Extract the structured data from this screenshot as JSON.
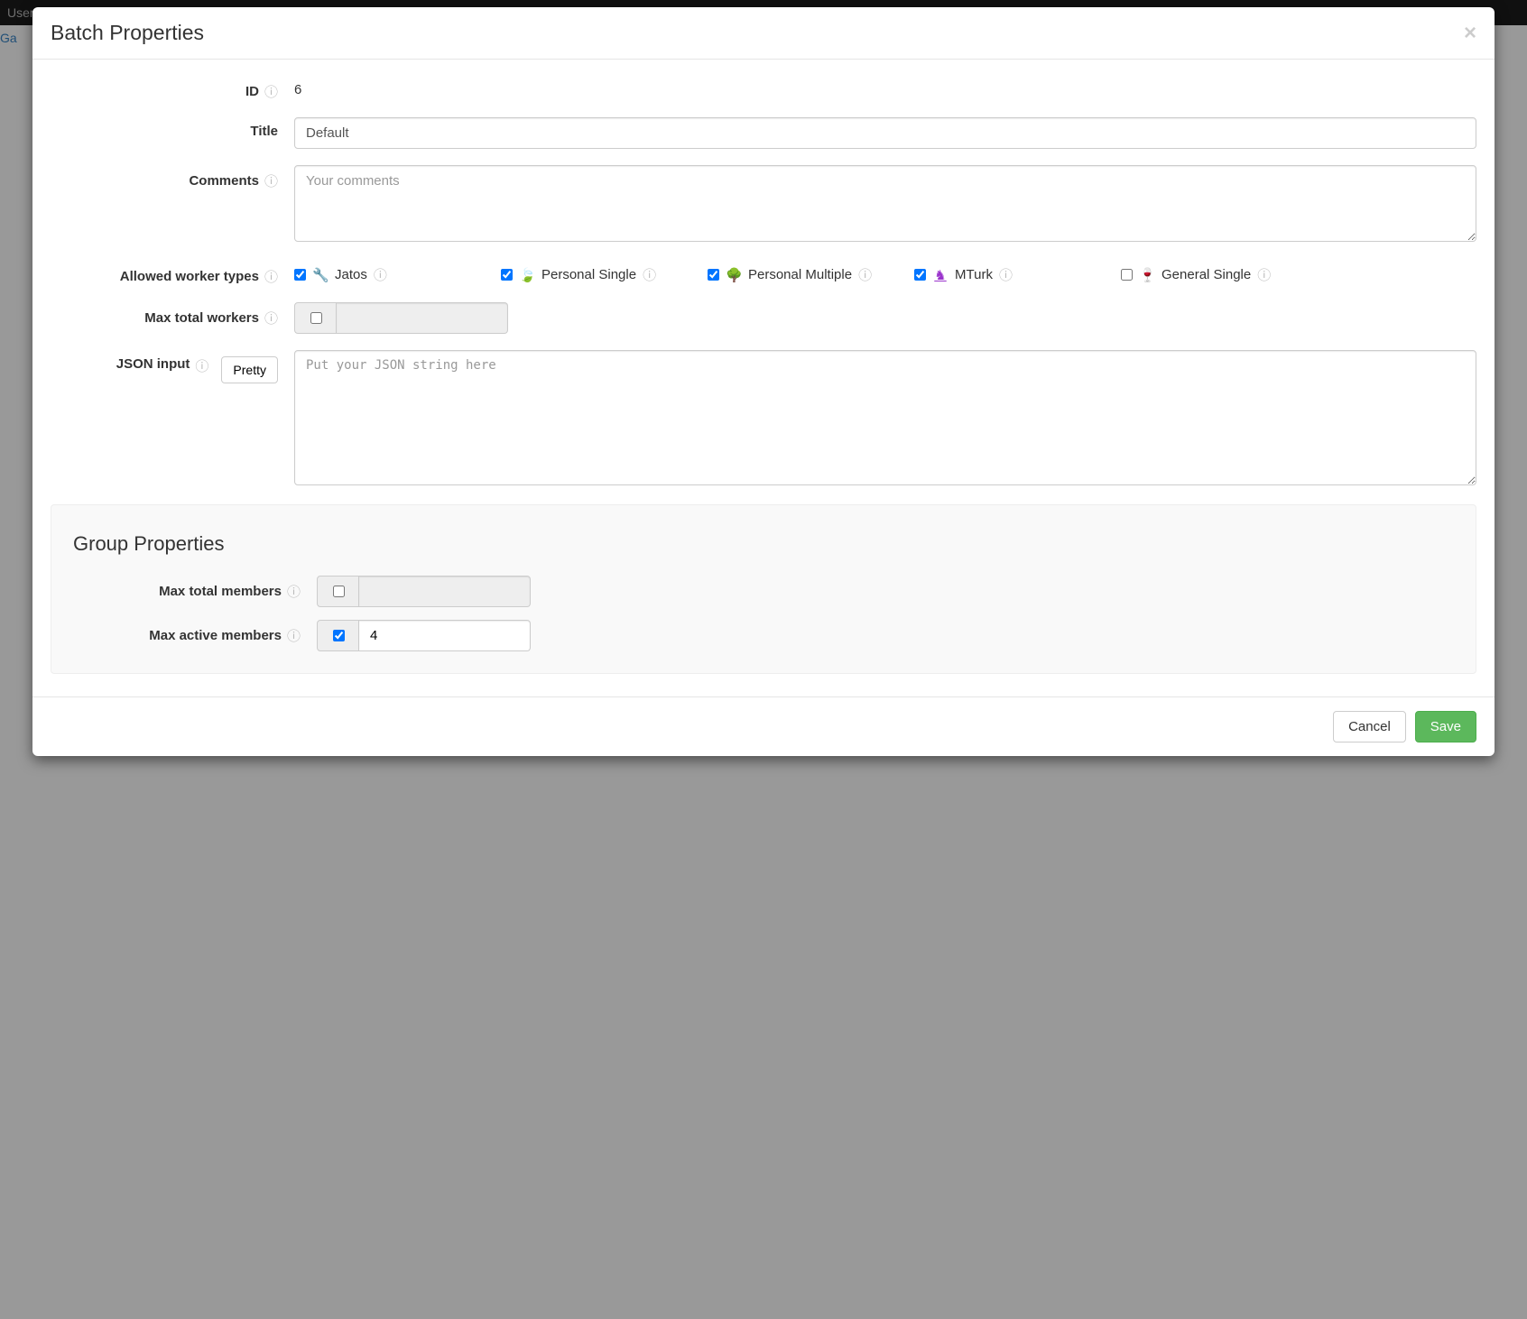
{
  "backdrop": {
    "top_nav": "User Manager",
    "link_fragment": "Ga"
  },
  "modal": {
    "title": "Batch Properties",
    "labels": {
      "id": "ID",
      "title": "Title",
      "comments": "Comments",
      "allowed_worker_types": "Allowed worker types",
      "max_total_workers": "Max total workers",
      "json_input": "JSON input",
      "pretty": "Pretty",
      "group_properties": "Group Properties",
      "max_total_members": "Max total members",
      "max_active_members": "Max active members"
    },
    "values": {
      "id": "6",
      "title": "Default",
      "comments_placeholder": "Your comments",
      "json_placeholder": "Put your JSON string here",
      "max_total_workers_enabled": false,
      "max_total_workers": "",
      "max_total_members_enabled": false,
      "max_total_members": "",
      "max_active_members_enabled": true,
      "max_active_members": "4"
    },
    "worker_types": [
      {
        "key": "jatos",
        "label": "Jatos",
        "checked": true,
        "icon": "wrench"
      },
      {
        "key": "personal_single",
        "label": "Personal Single",
        "checked": true,
        "icon": "leaf"
      },
      {
        "key": "personal_multiple",
        "label": "Personal Multiple",
        "checked": true,
        "icon": "tree"
      },
      {
        "key": "mturk",
        "label": "MTurk",
        "checked": true,
        "icon": "knight"
      },
      {
        "key": "general_single",
        "label": "General Single",
        "checked": false,
        "icon": "glass"
      }
    ],
    "footer": {
      "cancel": "Cancel",
      "save": "Save"
    }
  }
}
